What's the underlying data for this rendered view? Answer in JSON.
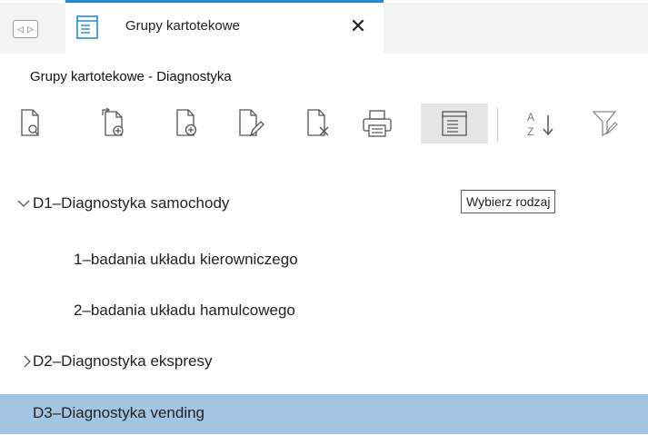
{
  "tab": {
    "title": "Grupy kartotekowe",
    "icon": "list-window-icon",
    "close_glyph": "✕"
  },
  "subtitle": "Grupy kartotekowe - Diagnostyka",
  "toolbar": {
    "buttons": [
      {
        "name": "preview-document-button",
        "icon": "document-search-icon"
      },
      {
        "name": "import-document-button",
        "icon": "document-import-add-icon"
      },
      {
        "name": "add-document-button",
        "icon": "document-add-icon"
      },
      {
        "name": "edit-document-button",
        "icon": "document-edit-icon"
      },
      {
        "name": "delete-document-button",
        "icon": "document-delete-icon"
      },
      {
        "name": "print-button",
        "icon": "printer-icon"
      },
      {
        "name": "choose-type-button",
        "icon": "list-window-icon",
        "active": true
      },
      {
        "name": "sort-button",
        "icon": "sort-az-icon"
      },
      {
        "name": "filter-button",
        "icon": "filter-edit-icon"
      }
    ]
  },
  "tooltip": "Wybierz rodzaj",
  "tree": [
    {
      "label": "D1–Diagnostyka samochody",
      "expanded": true,
      "level": 0
    },
    {
      "label": "1–badania układu kierowniczego",
      "level": 1
    },
    {
      "label": "2–badania układu hamulcowego",
      "level": 1
    },
    {
      "label": "D2–Diagnostyka ekspresy",
      "expanded": false,
      "level": 0
    },
    {
      "label": "D3–Diagnostyka vending",
      "level": 0,
      "selected": true
    }
  ],
  "colors": {
    "accent": "#1e8bd7",
    "selected": "#a3c4e2",
    "icon": "#555555"
  }
}
